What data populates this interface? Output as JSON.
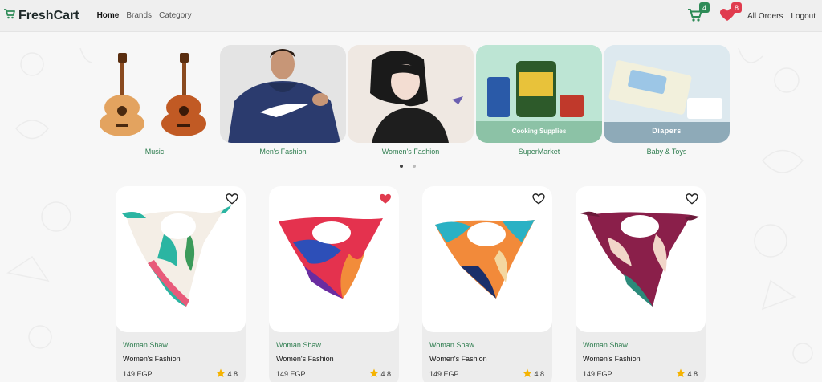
{
  "navbar": {
    "brand": "FreshCart",
    "links": [
      "Home",
      "Brands",
      "Category"
    ],
    "cart_count": "4",
    "wishlist_count": "8",
    "orders_label": "All Orders",
    "logout_label": "Logout"
  },
  "categories": [
    {
      "label": "Music",
      "image": "guitars"
    },
    {
      "label": "Men's Fashion",
      "image": "man-in-nike-hoodie"
    },
    {
      "label": "Women's Fashion",
      "image": "woman-illustration"
    },
    {
      "label": "SuperMarket",
      "image": "cooking-supplies",
      "caption": "Cooking Supplies"
    },
    {
      "label": "Baby & Toys",
      "image": "diapers",
      "caption": "Diapers"
    }
  ],
  "products": [
    {
      "category": "Woman Shaw",
      "name": "Women's Fashion",
      "price": "149 EGP",
      "rating": "4.8",
      "wishlisted": false
    },
    {
      "category": "Woman Shaw",
      "name": "Women's Fashion",
      "price": "149 EGP",
      "rating": "4.8",
      "wishlisted": true
    },
    {
      "category": "Woman Shaw",
      "name": "Women's Fashion",
      "price": "149 EGP",
      "rating": "4.8",
      "wishlisted": false
    },
    {
      "category": "Woman Shaw",
      "name": "Women's Fashion",
      "price": "149 EGP",
      "rating": "4.8",
      "wishlisted": false
    }
  ],
  "colors": {
    "accent": "#2e8b57",
    "heart": "#e03b4e",
    "star": "#f5b301"
  }
}
